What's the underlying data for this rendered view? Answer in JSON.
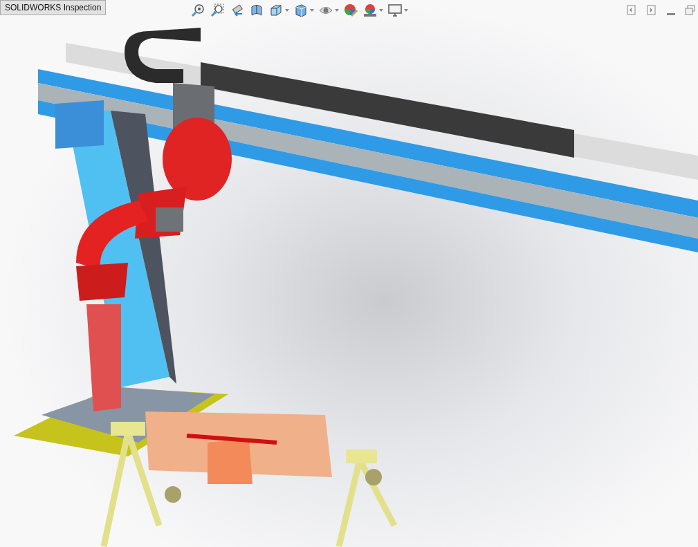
{
  "document_tab": {
    "label": "SOLIDWORKS Inspection"
  },
  "view_toolbar": [
    {
      "kind": "zoom-fit",
      "has_menu": false
    },
    {
      "kind": "zoom-area",
      "has_menu": false
    },
    {
      "kind": "previous-view",
      "has_menu": false
    },
    {
      "kind": "section",
      "has_menu": false
    },
    {
      "kind": "orientation",
      "has_menu": true
    },
    {
      "kind": "display-style",
      "has_menu": true
    },
    {
      "kind": "hide-show",
      "has_menu": true
    },
    {
      "kind": "appearance",
      "has_menu": false
    },
    {
      "kind": "scene",
      "has_menu": true
    },
    {
      "kind": "display",
      "has_menu": true
    }
  ],
  "window_controls": [
    {
      "kind": "panel-left"
    },
    {
      "kind": "panel-right"
    },
    {
      "kind": "minimize"
    },
    {
      "kind": "restore"
    }
  ]
}
